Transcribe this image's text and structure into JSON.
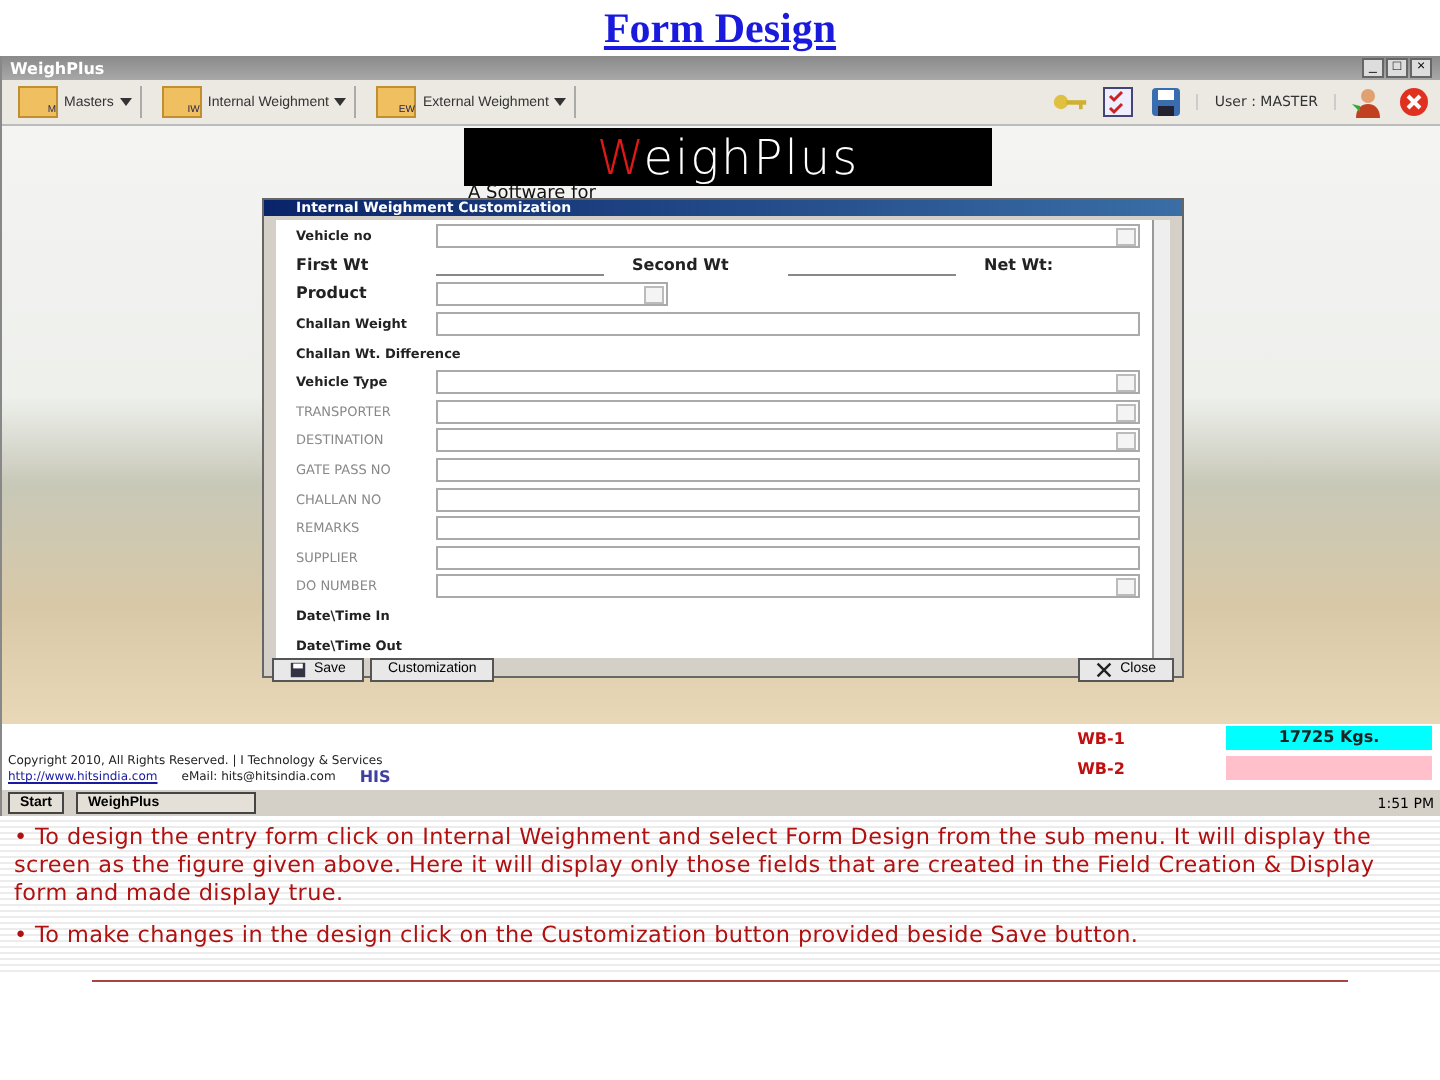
{
  "page_title": "Form Design",
  "app": {
    "title": "WeighPlus",
    "window_controls": [
      "_",
      "□",
      "×"
    ],
    "menus": [
      {
        "label": "Masters",
        "badge": "M"
      },
      {
        "label": "Internal Weighment",
        "badge": "IW"
      },
      {
        "label": "External Weighment",
        "badge": "EW"
      }
    ],
    "user": "User : MASTER",
    "logo": {
      "name": "WeighPlus",
      "tagline": "A Software for"
    },
    "dialog": {
      "title": "Internal Weighment Customization",
      "fields": [
        {
          "label": "Vehicle no",
          "kind": "combo",
          "bold": true,
          "large": false
        },
        {
          "kind": "weights",
          "items": [
            "First Wt",
            "Second Wt",
            "Net Wt:"
          ]
        },
        {
          "label": "Product",
          "kind": "short",
          "bold": true,
          "large": true
        },
        {
          "label": "Challan Weight",
          "kind": "text",
          "bold": true,
          "large": false
        },
        {
          "label": "Challan Wt. Difference",
          "kind": "none",
          "bold": true,
          "large": false
        },
        {
          "label": "Vehicle Type",
          "kind": "combo",
          "bold": true,
          "large": false
        },
        {
          "label": "TRANSPORTER",
          "kind": "combo",
          "bold": false,
          "large": false
        },
        {
          "label": "DESTINATION",
          "kind": "combo",
          "bold": false,
          "large": false
        },
        {
          "label": "GATE PASS NO",
          "kind": "text",
          "bold": false,
          "large": false
        },
        {
          "label": "CHALLAN NO",
          "kind": "text",
          "bold": false,
          "large": false
        },
        {
          "label": "REMARKS",
          "kind": "text",
          "bold": false,
          "large": false
        },
        {
          "label": "SUPPLIER",
          "kind": "text",
          "bold": false,
          "large": false
        },
        {
          "label": "DO NUMBER",
          "kind": "combo",
          "bold": false,
          "large": false
        },
        {
          "label": "Date\\Time In",
          "kind": "none",
          "bold": true,
          "large": false
        },
        {
          "label": "Date\\Time Out",
          "kind": "none",
          "bold": true,
          "large": false
        }
      ],
      "buttons": {
        "save": "Save",
        "custom": "Customization",
        "close": "Close"
      }
    },
    "footer": {
      "copyright": "Copyright 2010, All Rights Reserved. | I Technology & Services",
      "url": "http://www.hitsindia.com",
      "email": "eMail: hits@hitsindia.com",
      "brand": "HIS"
    },
    "scales": [
      {
        "label": "WB-1",
        "reading": "17725 Kgs.",
        "color": "#00ffff"
      },
      {
        "label": "WB-2",
        "color": "#ffc0cb"
      }
    ],
    "taskbar": {
      "start": "Start",
      "task": "WeighPlus",
      "time": "1:51 PM"
    }
  },
  "notes": [
    "• To design the entry form click on Internal Weighment and select Form Design from the sub menu. It will display the screen as the figure given above. Here it will display only those fields that are created in the Field Creation & Display form and made display true.",
    "• To make changes in the design click on the Customization button provided beside Save button."
  ]
}
